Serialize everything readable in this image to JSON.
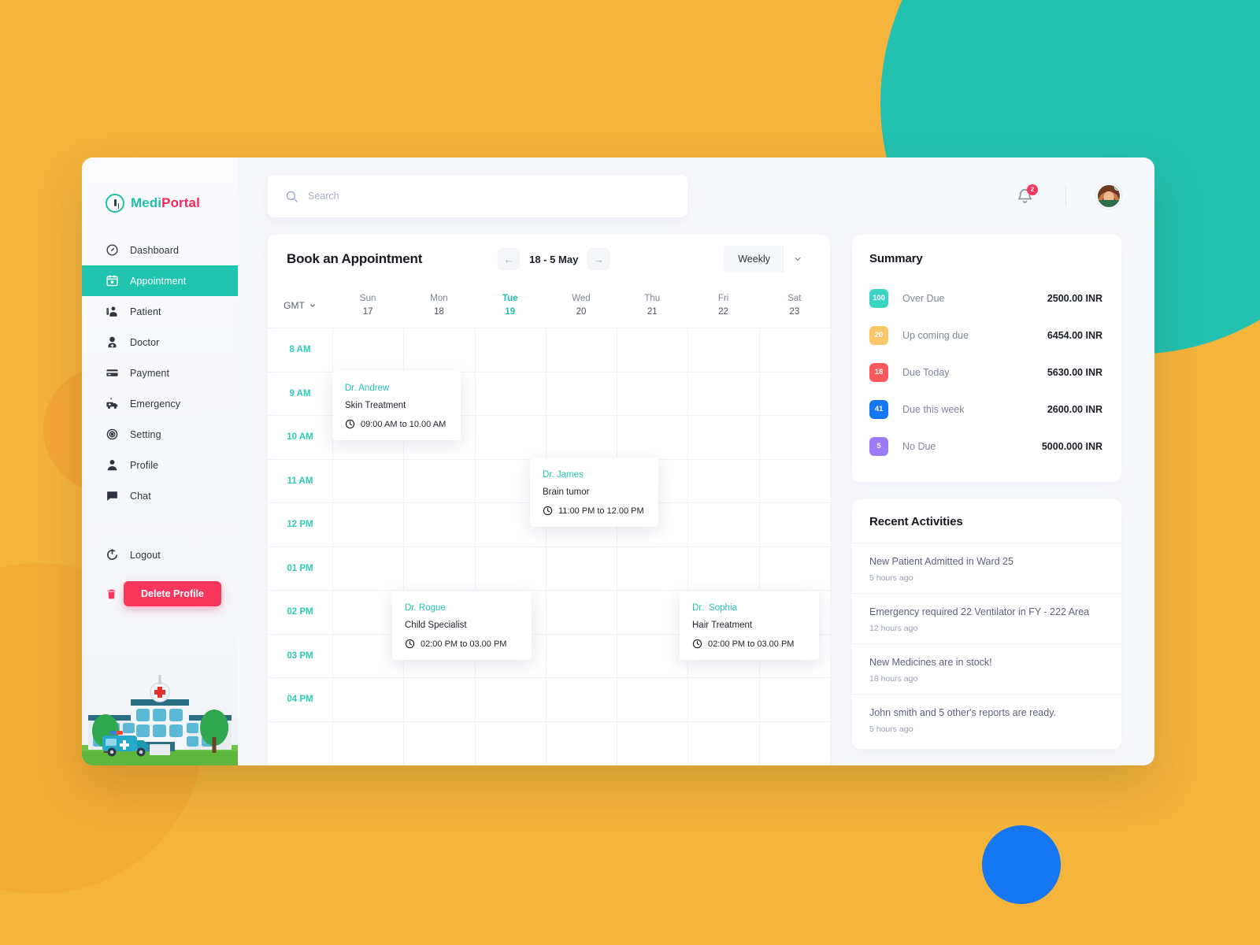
{
  "brand": {
    "part1": "Medi",
    "part2": "Portal"
  },
  "sidebar": {
    "items": [
      {
        "label": "Dashboard",
        "icon": "dashboard-icon"
      },
      {
        "label": "Appointment",
        "icon": "calendar-icon"
      },
      {
        "label": "Patient",
        "icon": "patient-icon"
      },
      {
        "label": "Doctor",
        "icon": "doctor-icon"
      },
      {
        "label": "Payment",
        "icon": "payment-icon"
      },
      {
        "label": "Emergency",
        "icon": "ambulance-icon"
      },
      {
        "label": "Setting",
        "icon": "gear-icon"
      },
      {
        "label": "Profile",
        "icon": "person-icon"
      },
      {
        "label": "Chat",
        "icon": "chat-icon"
      }
    ],
    "active_index": 1,
    "logout_label": "Logout",
    "delete_label": "Delete Profile",
    "accent_active": "#20C4AE",
    "delete_color": "#F9375C"
  },
  "topbar": {
    "search_placeholder": "Search",
    "search_value": "",
    "notification_count": "2"
  },
  "calendar": {
    "title": "Book an Appointment",
    "date_range": "18 - 5 May",
    "prev_label": "←",
    "next_label": "→",
    "view_label": "Weekly",
    "timezone": "GMT",
    "days": [
      {
        "name": "Sun",
        "num": "17",
        "today": false
      },
      {
        "name": "Mon",
        "num": "18",
        "today": false
      },
      {
        "name": "Tue",
        "num": "19",
        "today": true
      },
      {
        "name": "Wed",
        "num": "20",
        "today": false
      },
      {
        "name": "Thu",
        "num": "21",
        "today": false
      },
      {
        "name": "Fri",
        "num": "22",
        "today": false
      },
      {
        "name": "Sat",
        "num": "23",
        "today": false
      }
    ],
    "times": [
      "8 AM",
      "9 AM",
      "10 AM",
      "11 AM",
      "12 PM",
      "01 PM",
      "02 PM",
      "03 PM",
      "04 PM"
    ],
    "appointments": [
      {
        "doctor": "Dr. Andrew",
        "service": "Skin Treatment",
        "time": "09:00 AM to 10.00 AM"
      },
      {
        "doctor": "Dr. James",
        "service": "Brain tumor",
        "time": "11:00 PM to 12.00 PM"
      },
      {
        "doctor": "Dr. Rogue",
        "service": "Child Specialist",
        "time": "02:00 PM to 03.00 PM"
      },
      {
        "doctor": "Dr.  Sophia",
        "service": "Hair Treatment",
        "time": "02:00 PM to 03.00 PM"
      }
    ]
  },
  "summary": {
    "title": "Summary",
    "rows": [
      {
        "count": "100",
        "label": "Over Due",
        "value": "2500.00 INR",
        "color": "#3BD4C3"
      },
      {
        "count": "20",
        "label": "Up coming due",
        "value": "6454.00 INR",
        "color": "#FBC56A"
      },
      {
        "count": "18",
        "label": "Due Today",
        "value": "5630.00 INR",
        "color": "#F9595B"
      },
      {
        "count": "41",
        "label": "Due this week",
        "value": "2600.00 INR",
        "color": "#1677F2"
      },
      {
        "count": "5",
        "label": "No Due",
        "value": "5000.000 INR",
        "color": "#9B7BF7"
      }
    ]
  },
  "activities": {
    "title": "Recent Activities",
    "rows": [
      {
        "text": "New Patient Admitted in Ward 25",
        "time": "5 hours ago"
      },
      {
        "text": "Emergency required 22 Ventilator in FY - 222 Area",
        "time": "12 hours ago"
      },
      {
        "text": "New Medicines are in stock!",
        "time": "18 hours ago"
      },
      {
        "text": "John smith and 5 other's reports are ready.",
        "time": "5 hours ago"
      }
    ]
  }
}
